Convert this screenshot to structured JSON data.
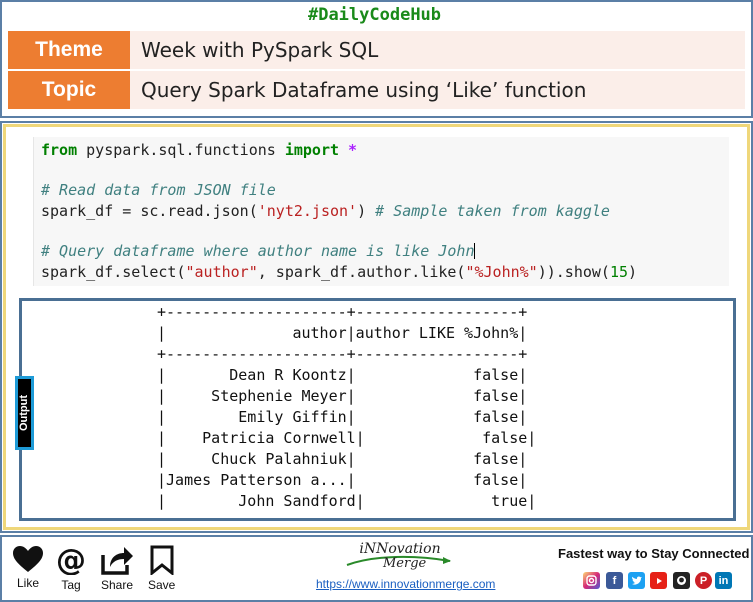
{
  "header": {
    "hashtag": "#DailyCodeHub",
    "theme_label": "Theme",
    "theme_value": "Week with PySpark SQL",
    "topic_label": "Topic",
    "topic_value": "Query Spark Dataframe using ‘Like’ function"
  },
  "code": {
    "line1": {
      "kw_from": "from",
      "module": " pyspark.sql.functions ",
      "kw_import": "import",
      "star": " *"
    },
    "comment1": "# Read data from JSON file",
    "line3": {
      "lhs": "spark_df = sc.read.json(",
      "arg": "'nyt2.json'",
      "rhs": ") ",
      "comment": "# Sample taken from kaggle"
    },
    "comment2": "# Query dataframe where author name is like John",
    "line5": {
      "a": "spark_df.select(",
      "s1": "\"author\"",
      "b": ", spark_df.author.like(",
      "s2": "\"%John%\"",
      "c": ")).show(",
      "n": "15",
      "d": ")"
    }
  },
  "output": {
    "tag": "Output",
    "border_top": "+--------------------+------------------+",
    "header_row": "|              author|author LIKE %John%|",
    "border_mid": "+--------------------+------------------+",
    "rows": [
      "|       Dean R Koontz|             false|",
      "|     Stephenie Meyer|             false|",
      "|        Emily Giffin|             false|",
      "|    Patricia Cornwell|             false|",
      "|     Chuck Palahniuk|             false|",
      "|James Patterson a...|             false|",
      "|        John Sandford|              true|"
    ]
  },
  "footer": {
    "like": "Like",
    "tag": "Tag",
    "share": "Share",
    "save": "Save",
    "logo_line1": "iNNovation",
    "logo_line2": "Merge",
    "url": "https://www.innovationmerge.com",
    "stay_connected": "Fastest way to Stay Connected"
  },
  "colors": {
    "accent_orange": "#ed7d31",
    "hashtag_green": "#1a8a1a",
    "frame_blue": "#5b7fa6",
    "frame_yellow": "#efd77a"
  },
  "social_icons": [
    "instagram-icon",
    "facebook-icon",
    "twitter-icon",
    "youtube-icon",
    "github-icon",
    "pinterest-icon",
    "linkedin-icon"
  ]
}
